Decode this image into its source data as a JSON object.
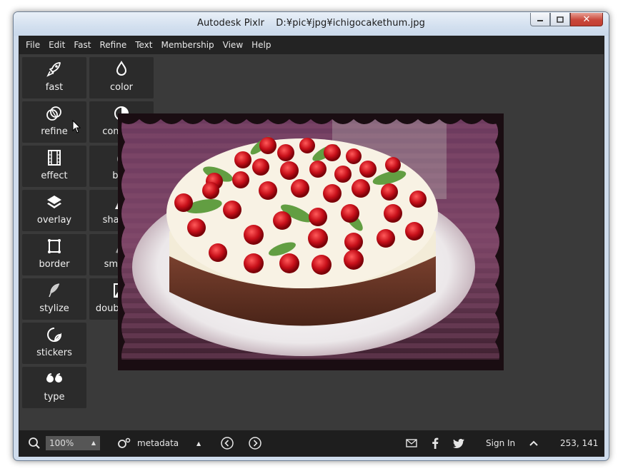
{
  "window": {
    "app_name": "Autodesk Pixlr",
    "file_path": "D:¥pic¥jpg¥ichigocakethum.jpg",
    "min_symbol": "▭",
    "max_symbol": "□",
    "close_symbol": "✕"
  },
  "menu": [
    "File",
    "Edit",
    "Fast",
    "Refine",
    "Text",
    "Membership",
    "View",
    "Help"
  ],
  "tools": [
    {
      "label": "fast",
      "icon": "rocket-icon"
    },
    {
      "label": "color",
      "icon": "drop-outline-icon"
    },
    {
      "label": "refine",
      "icon": "overlap-circles-icon"
    },
    {
      "label": "contrast",
      "icon": "half-circle-icon"
    },
    {
      "label": "effect",
      "icon": "film-icon"
    },
    {
      "label": "blur",
      "icon": "drop-blur-icon"
    },
    {
      "label": "overlay",
      "icon": "layers-icon"
    },
    {
      "label": "sharpen",
      "icon": "triangle-sharp-icon"
    },
    {
      "label": "border",
      "icon": "frame-icon"
    },
    {
      "label": "smooth",
      "icon": "triangle-smooth-icon"
    },
    {
      "label": "stylize",
      "icon": "feather-icon"
    },
    {
      "label": "double exp",
      "icon": "image-icon"
    },
    {
      "label": "stickers",
      "icon": "sticker-icon"
    },
    {
      "label": "type",
      "icon": "quote-icon"
    }
  ],
  "status": {
    "zoom_value": "100%",
    "zoom_arrow": "▲",
    "metadata_label": "metadata",
    "metadata_arrow": "▲",
    "sign_in": "Sign In",
    "coords": "253,  141"
  }
}
